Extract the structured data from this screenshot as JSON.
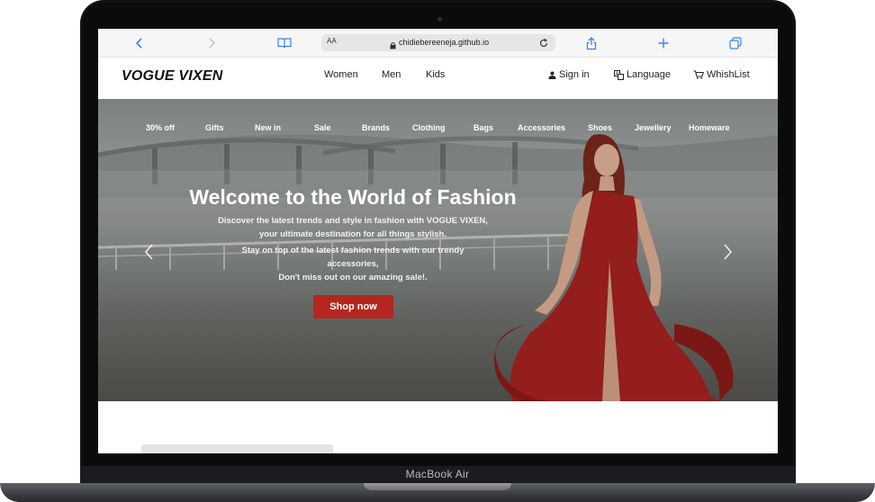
{
  "device": {
    "label": "MacBook Air"
  },
  "browser": {
    "aa_label": "AA",
    "url": "chidiebereeneja.github.io",
    "icons": [
      "back-icon",
      "forward-icon",
      "bookmarks-icon",
      "lock-icon",
      "reload-icon",
      "share-icon",
      "new-tab-icon",
      "tabs-icon"
    ]
  },
  "site": {
    "logo": "VOGUE VIXEN",
    "nav": [
      "Women",
      "Men",
      "Kids"
    ],
    "utility": {
      "signin": "Sign in",
      "language": "Language",
      "wishlist": "WhishList"
    }
  },
  "hero": {
    "categories": [
      "30% off",
      "Gifts",
      "New in",
      "Sale",
      "Brands",
      "Clothing",
      "Bags",
      "Accessories",
      "Shoes",
      "Jewellery",
      "Homeware"
    ],
    "title": "Welcome to the World of Fashion",
    "lines": [
      "Discover the latest trends and style in fashion with VOGUE VIXEN,",
      "your ultimate destination for all things stylish.",
      "Stay on top of the latest fashion trends with our trendy",
      "accessories,",
      "Don't miss out on our amazing sale!."
    ],
    "cta": "Shop now"
  },
  "colors": {
    "cta": "#b5261e",
    "dress": "#a8231f"
  }
}
